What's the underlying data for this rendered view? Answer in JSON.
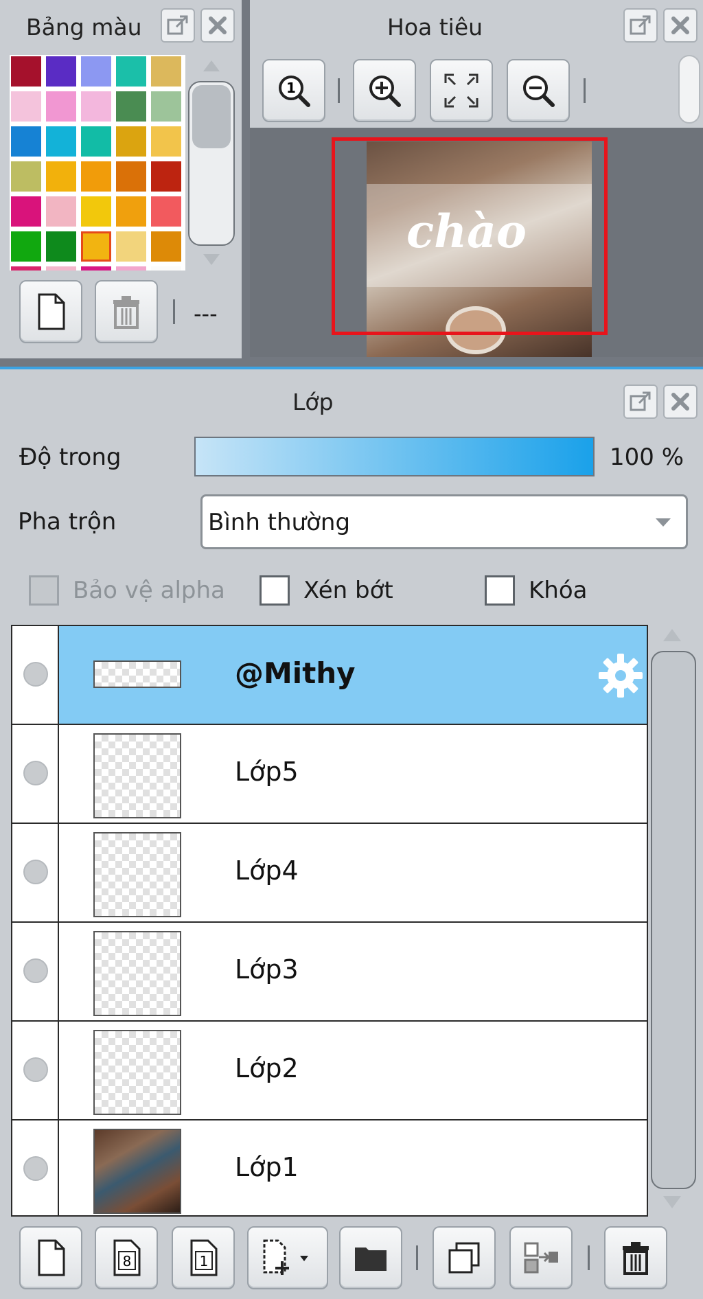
{
  "palette_panel": {
    "title": "Bảng màu",
    "swatches": [
      "#a5112c",
      "#5a2cc4",
      "#8c98f2",
      "#1bbfa9",
      "#dcb85c",
      "#f4c3dc",
      "#f197d2",
      "#f3b7dd",
      "#4a8c52",
      "#9dc49a",
      "#1682d4",
      "#13b2d8",
      "#12bca6",
      "#dba410",
      "#f2c44b",
      "#bdbd62",
      "#f2b10c",
      "#f19c0a",
      "#da7108",
      "#bd2410",
      "#d9137b",
      "#f2b5c2",
      "#f2c80c",
      "#f0a00d",
      "#f25a5e",
      "#11a80f",
      "#0e8a1c",
      "#f2b411",
      "#f2d47c",
      "#dd8a07",
      "#d8256b",
      "#f4b7cc",
      "#d81685",
      "#f2a6cc",
      "#fbfbfb"
    ],
    "selected_swatch_index": 27,
    "more_label": "---",
    "icons": {
      "detach": "detach-icon",
      "close": "close-icon",
      "new": "new-page-icon",
      "delete": "trash-icon"
    }
  },
  "navigator_panel": {
    "title": "Hoa tiêu",
    "icons": [
      "zoom-actual-icon",
      "zoom-in-icon",
      "fit-screen-icon",
      "zoom-out-icon"
    ],
    "preview_text": "chào",
    "frame_color": "#e8141b"
  },
  "layer_panel": {
    "title": "Lớp",
    "opacity_label": "Độ trong",
    "opacity_value": "100 %",
    "opacity_fraction": 1.0,
    "blend_label": "Pha trộn",
    "blend_value": "Bình thường",
    "protect_alpha_label": "Bảo vệ alpha",
    "clip_label": "Xén bớt",
    "lock_label": "Khóa",
    "protect_alpha_checked": false,
    "clip_checked": false,
    "lock_checked": false,
    "layers": [
      {
        "name": "@Mithy",
        "selected": true,
        "thumb": "wide"
      },
      {
        "name": "Lớp5",
        "selected": false,
        "thumb": "blank"
      },
      {
        "name": "Lớp4",
        "selected": false,
        "thumb": "blank"
      },
      {
        "name": "Lớp3",
        "selected": false,
        "thumb": "blank"
      },
      {
        "name": "Lớp2",
        "selected": false,
        "thumb": "blank"
      },
      {
        "name": "Lớp1",
        "selected": false,
        "thumb": "photo"
      }
    ],
    "toolbar_icons": [
      "new-layer-icon",
      "new-8bit-layer-icon",
      "new-1bit-layer-icon",
      "add-layer-menu-icon",
      "folder-icon",
      "duplicate-layer-icon",
      "merge-down-icon",
      "delete-layer-icon"
    ],
    "toolbar_8bit_label": "8",
    "toolbar_1bit_label": "1"
  },
  "colors": {
    "panel_bg": "#c9cdd2",
    "selected_row": "#83cbf4",
    "accent_line": "#3ba3e4"
  }
}
